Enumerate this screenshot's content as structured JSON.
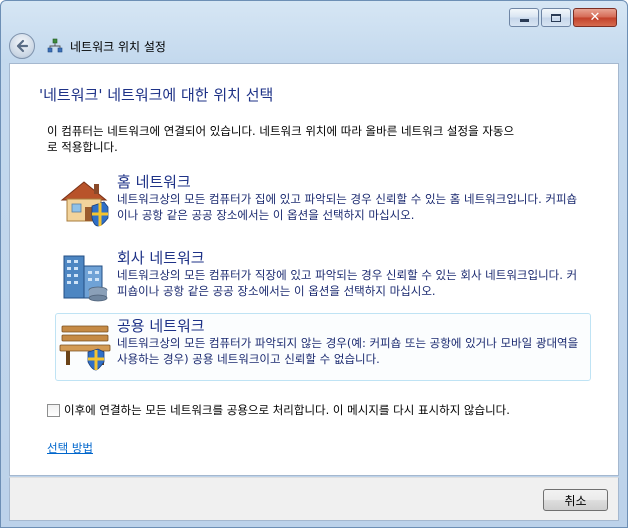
{
  "window": {
    "title": "네트워크 위치 설정",
    "close_glyph": "✕"
  },
  "main": {
    "heading": "'네트워크' 네트워크에 대한 위치 선택",
    "intro": "이 컴퓨터는 네트워크에 연결되어 있습니다. 네트워크 위치에 따라 올바른 네트워크 설정을 자동으로 적용합니다.",
    "options": [
      {
        "title": "홈 네트워크",
        "description": "네트워크상의 모든 컴퓨터가 집에 있고 파악되는 경우 신뢰할 수 있는 홈 네트워크입니다. 커피숍이나 공항 같은 공공 장소에서는 이 옵션을 선택하지 마십시오.",
        "icon": "home-icon"
      },
      {
        "title": "회사 네트워크",
        "description": "네트워크상의 모든 컴퓨터가 직장에 있고 파악되는 경우 신뢰할 수 있는 회사 네트워크입니다. 커피숍이나 공항 같은 공공 장소에서는 이 옵션을 선택하지 마십시오.",
        "icon": "office-building-icon"
      },
      {
        "title": "공용 네트워크",
        "description": "네트워크상의 모든 컴퓨터가 파악되지 않는 경우(예: 커피숍 또는 공항에 있거나 모바일 광대역을 사용하는 경우) 공용 네트워크이고 신뢰할 수 없습니다.",
        "icon": "park-bench-icon"
      }
    ],
    "checkbox_label": "이후에 연결하는 모든 네트워크를 공용으로 처리합니다. 이 메시지를 다시 표시하지 않습니다.",
    "checkbox_checked": false,
    "help_link": "선택 방법"
  },
  "footer": {
    "cancel_label": "취소"
  },
  "colors": {
    "heading": "#1e3287",
    "link": "#0066cc",
    "selected_border": "#bfe3f4"
  }
}
